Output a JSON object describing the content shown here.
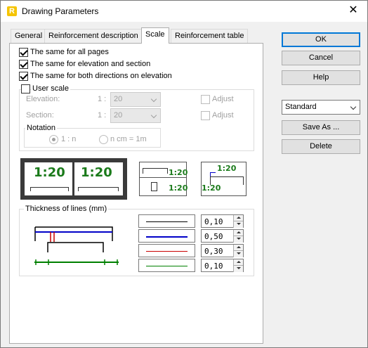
{
  "window": {
    "title": "Drawing Parameters",
    "app_icon_letter": "R"
  },
  "tabs": [
    {
      "label": "General"
    },
    {
      "label": "Reinforcement description"
    },
    {
      "label": "Scale"
    },
    {
      "label": "Reinforcement table"
    }
  ],
  "active_tab": "Scale",
  "options": {
    "same_all_pages": "The same for all pages",
    "same_elev_section": "The same for elevation and section",
    "same_both_dirs": "The same for both directions on elevation",
    "user_scale": "User scale"
  },
  "user_scale": {
    "elevation_label": "Elevation:",
    "section_label": "Section:",
    "ratio_prefix": "1 :",
    "elevation_value": "20",
    "section_value": "20",
    "adjust_label": "Adjust"
  },
  "notation": {
    "title": "Notation",
    "opt1": "1 : n",
    "opt2": "n cm = 1m"
  },
  "previews": {
    "scale_text": "1:20"
  },
  "thickness": {
    "title": "Thickness of lines (mm)",
    "rows": [
      {
        "color": "#000000",
        "value": "0,10"
      },
      {
        "color": "#0000c8",
        "value": "0,50"
      },
      {
        "color": "#c80000",
        "value": "0,30"
      },
      {
        "color": "#008000",
        "value": "0,10"
      }
    ]
  },
  "buttons": {
    "ok": "OK",
    "cancel": "Cancel",
    "help": "Help",
    "preset": "Standard",
    "save_as": "Save As ...",
    "delete": "Delete"
  }
}
